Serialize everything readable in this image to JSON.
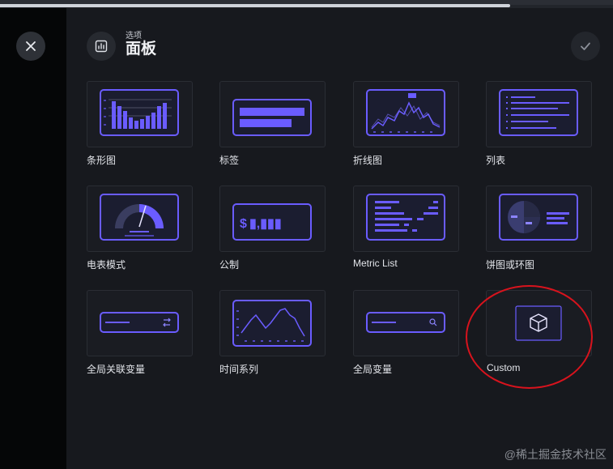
{
  "header": {
    "subtitle": "选项",
    "title": "面板"
  },
  "panels": [
    {
      "label": "条形图",
      "icon": "bar-chart-icon"
    },
    {
      "label": "标签",
      "icon": "label-icon"
    },
    {
      "label": "折线图",
      "icon": "line-chart-icon"
    },
    {
      "label": "列表",
      "icon": "list-icon"
    },
    {
      "label": "电表模式",
      "icon": "gauge-icon"
    },
    {
      "label": "公制",
      "icon": "metric-icon",
      "preview_text": "$",
      "preview_value": "▮,▮▮▮"
    },
    {
      "label": "Metric List",
      "icon": "metric-list-icon"
    },
    {
      "label": "饼图或环图",
      "icon": "pie-chart-icon"
    },
    {
      "label": "全局关联变量",
      "icon": "global-linked-variable-icon"
    },
    {
      "label": "时间系列",
      "icon": "time-series-icon"
    },
    {
      "label": "全局变量",
      "icon": "global-variable-icon"
    },
    {
      "label": "Custom",
      "icon": "cube-icon"
    }
  ],
  "watermark": "@稀土掘金技术社区",
  "colors": {
    "accent": "#6a5cff",
    "background": "#17191e",
    "highlight": "#d8131d"
  }
}
